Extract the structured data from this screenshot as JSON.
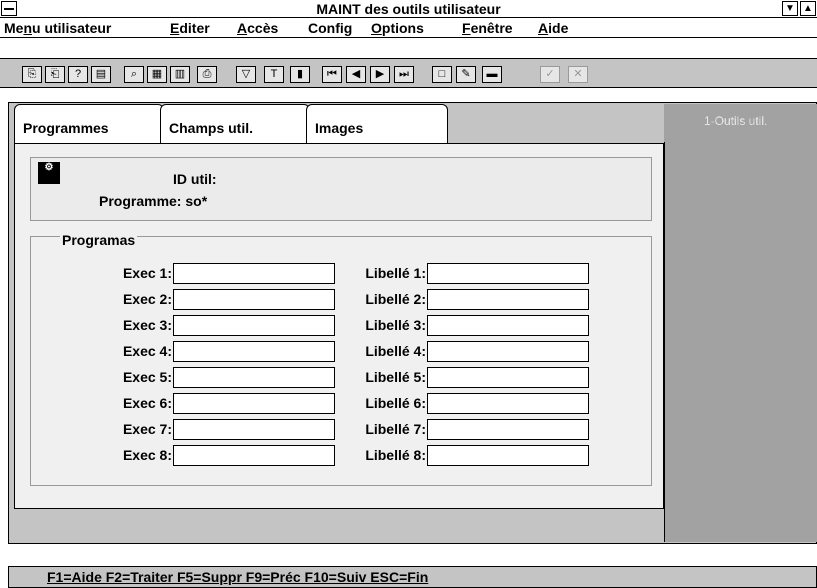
{
  "window": {
    "title": "MAINT des outils utilisateur",
    "dropdown_glyph": "▼",
    "scroll_glyph": "▲"
  },
  "menubar": [
    {
      "pre": "Me",
      "key": "n",
      "post": "u utilisateur"
    },
    {
      "pre": "",
      "key": "E",
      "post": "diter"
    },
    {
      "pre": "",
      "key": "A",
      "post": "ccès"
    },
    {
      "pre": "Confi",
      "key": "g",
      "post": ""
    },
    {
      "pre": "",
      "key": "O",
      "post": "ptions"
    },
    {
      "pre": "",
      "key": "F",
      "post": "enêtre"
    },
    {
      "pre": "",
      "key": "A",
      "post": "ide"
    }
  ],
  "toolbar": [
    {
      "icon": "copy-icon",
      "glyph": "⎘"
    },
    {
      "icon": "paste-icon",
      "glyph": "⎗"
    },
    {
      "icon": "help-icon",
      "glyph": "?"
    },
    {
      "icon": "form-icon",
      "glyph": "▤"
    },
    {
      "icon": "search-icon",
      "glyph": "⌕"
    },
    {
      "icon": "grid-icon",
      "glyph": "▦"
    },
    {
      "icon": "table-icon",
      "glyph": "▥"
    },
    {
      "icon": "print-icon",
      "glyph": "⎙"
    },
    {
      "icon": "filter-icon",
      "glyph": "▽"
    },
    {
      "icon": "text-icon",
      "glyph": "T"
    },
    {
      "icon": "columns-icon",
      "glyph": "▮"
    },
    {
      "icon": "first-record-icon",
      "glyph": "⏮"
    },
    {
      "icon": "prev-record-icon",
      "glyph": "◀"
    },
    {
      "icon": "next-record-icon",
      "glyph": "▶"
    },
    {
      "icon": "last-record-icon",
      "glyph": "⏭"
    },
    {
      "icon": "new-record-icon",
      "glyph": "□"
    },
    {
      "icon": "edit-icon",
      "glyph": "✎"
    },
    {
      "icon": "delete-icon",
      "glyph": "▬"
    },
    {
      "icon": "validate-icon",
      "glyph": "✓"
    },
    {
      "icon": "cancel-icon",
      "glyph": "✕"
    }
  ],
  "tabs": [
    "Programmes",
    "Champs util.",
    "Images",
    "1-Outils util."
  ],
  "header": {
    "icon_glyph": "⚙",
    "id_label": "ID util:",
    "programme_label": "Programme: so*"
  },
  "group": {
    "title": "Programas",
    "exec_labels": [
      "Exec 1:",
      "Exec 2:",
      "Exec 3:",
      "Exec 4:",
      "Exec 5:",
      "Exec 6:",
      "Exec 7:",
      "Exec 8:"
    ],
    "libelle_labels": [
      "Libellé 1:",
      "Libellé 2:",
      "Libellé 3:",
      "Libellé 4:",
      "Libellé 5:",
      "Libellé 6:",
      "Libellé 7:",
      "Libellé 8:"
    ],
    "exec_values": [
      "",
      "",
      "",
      "",
      "",
      "",
      "",
      ""
    ],
    "libelle_values": [
      "",
      "",
      "",
      "",
      "",
      "",
      "",
      ""
    ]
  },
  "status": "F1=Aide  F2=Traiter  F5=Suppr  F9=Préc  F10=Suiv  ESC=Fin"
}
